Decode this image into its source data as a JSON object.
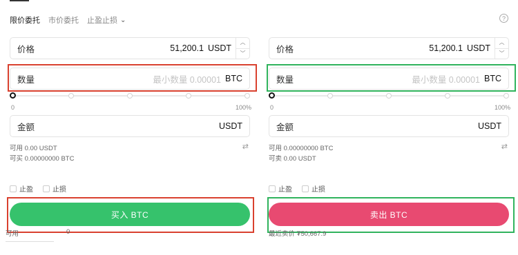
{
  "tabs": [
    {
      "label": "限价委托",
      "active": true
    },
    {
      "label": "市价委托",
      "active": false
    },
    {
      "label": "止盈止损",
      "active": false
    }
  ],
  "buy": {
    "price_label": "价格",
    "price_value": "51,200.1",
    "price_unit": "USDT",
    "qty_label": "数量",
    "qty_placeholder": "最小数量 0.00001",
    "qty_unit": "BTC",
    "slider_min": "0",
    "slider_max": "100%",
    "amount_label": "金额",
    "amount_unit": "USDT",
    "available": "可用 0.00 USDT",
    "can_buy": "可买 0.00000000 BTC",
    "take_profit": "止盈",
    "stop_loss": "止损",
    "action_label": "买入 BTC",
    "bottom_label": "可用",
    "bottom_value": "0"
  },
  "sell": {
    "price_label": "价格",
    "price_value": "51,200.1",
    "price_unit": "USDT",
    "qty_label": "数量",
    "qty_placeholder": "最小数量 0.00001",
    "qty_unit": "BTC",
    "slider_min": "0",
    "slider_max": "100%",
    "amount_label": "金额",
    "amount_unit": "USDT",
    "available": "可用 0.00000000 BTC",
    "can_sell": "可卖 0.00 USDT",
    "take_profit": "止盈",
    "stop_loss": "止损",
    "action_label": "卖出 BTC",
    "bottom_text": "最近卖价 ₮50,667.9"
  },
  "colors": {
    "buy": "#36c26c",
    "sell": "#e84a71",
    "highlight_red": "#d9402e",
    "highlight_green": "#2fb35c"
  },
  "icons": {
    "help": "help-circle-icon",
    "swap": "swap-arrows-icon",
    "chevron": "chevron-down-icon",
    "stepper_up": "chevron-up-icon",
    "stepper_down": "chevron-down-icon"
  }
}
